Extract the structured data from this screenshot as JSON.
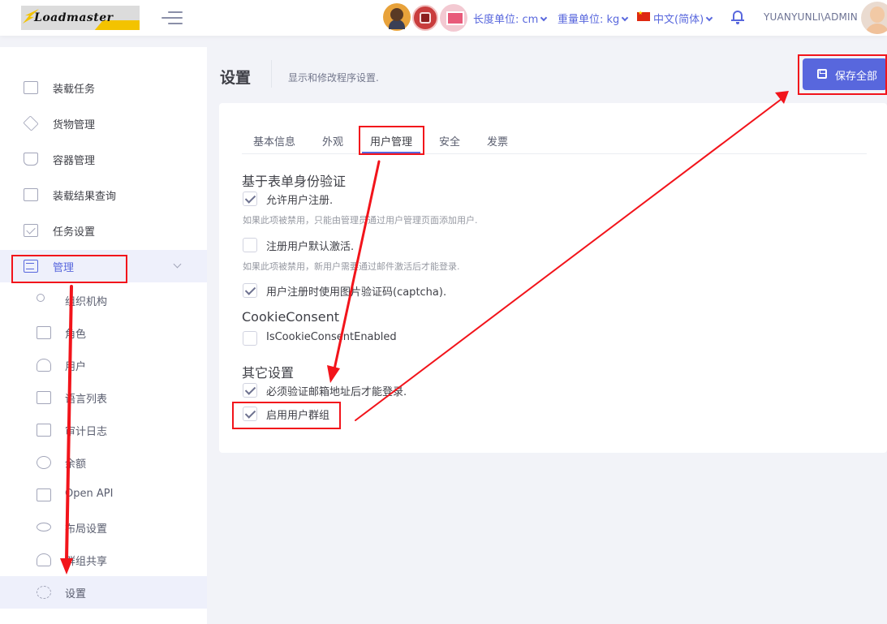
{
  "header": {
    "logo_text": "Loadmaster",
    "length_unit": "长度单位: cm",
    "weight_unit": "重量单位: kg",
    "language": "中文(简体)",
    "user": "YUANYUNLI\\ADMIN"
  },
  "sidebar": {
    "items": [
      {
        "label": "装载任务",
        "icon": "cube-icon"
      },
      {
        "label": "货物管理",
        "icon": "layers-icon"
      },
      {
        "label": "容器管理",
        "icon": "tray-icon"
      },
      {
        "label": "装载结果查询",
        "icon": "cube-icon"
      },
      {
        "label": "任务设置",
        "icon": "checkbox-icon"
      },
      {
        "label": "管理",
        "icon": "sliders-icon"
      }
    ],
    "sub_items": [
      {
        "label": "组织机构",
        "icon": "org-chart-icon"
      },
      {
        "label": "角色",
        "icon": "briefcase-icon"
      },
      {
        "label": "用户",
        "icon": "users-icon"
      },
      {
        "label": "语言列表",
        "icon": "window-icon"
      },
      {
        "label": "审计日志",
        "icon": "log-icon"
      },
      {
        "label": "余额",
        "icon": "coins-icon"
      },
      {
        "label": "Open API",
        "icon": "monitor-icon"
      },
      {
        "label": "布局设置",
        "icon": "eye-icon"
      },
      {
        "label": "群组共享",
        "icon": "users-icon"
      },
      {
        "label": "设置",
        "icon": "gear-icon"
      }
    ]
  },
  "page": {
    "title": "设置",
    "description": "显示和修改程序设置.",
    "save_all": "保存全部"
  },
  "tabs": [
    "基本信息",
    "外观",
    "用户管理",
    "安全",
    "发票"
  ],
  "active_tab": "用户管理",
  "sections": {
    "form_auth": {
      "title": "基于表单身份验证",
      "allow_register": {
        "label": "允许用户注册.",
        "checked": true,
        "help": "如果此项被禁用，只能由管理员通过用户管理页面添加用户."
      },
      "default_active": {
        "label": "注册用户默认激活.",
        "checked": false,
        "help": "如果此项被禁用，新用户需要通过邮件激活后才能登录."
      },
      "captcha": {
        "label": "用户注册时使用图片验证码(captcha).",
        "checked": true
      }
    },
    "cookie": {
      "title": "CookieConsent",
      "enabled": {
        "label": "IsCookieConsentEnabled",
        "checked": false
      }
    },
    "other": {
      "title": "其它设置",
      "email_confirm": {
        "label": "必须验证邮箱地址后才能登录.",
        "checked": true
      },
      "user_groups": {
        "label": "启用用户群组",
        "checked": true
      }
    }
  },
  "colors": {
    "accent": "#5867dd",
    "annotation": "#f2141b"
  }
}
